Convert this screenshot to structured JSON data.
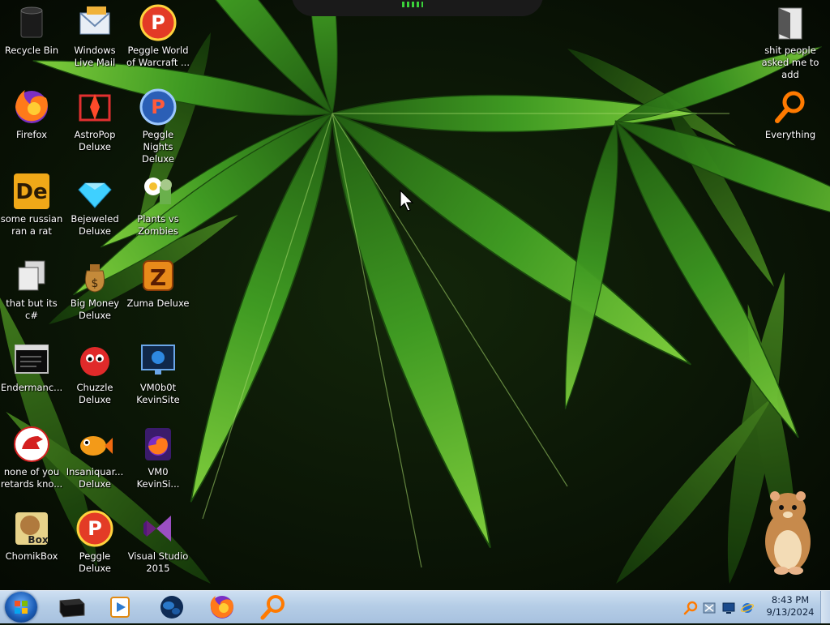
{
  "desktop": {
    "icons": [
      {
        "id": "recycle-bin",
        "label": "Recycle Bin",
        "icon": "recycle-bin-icon"
      },
      {
        "id": "windows-live-mail",
        "label": "Windows Live Mail",
        "icon": "mail-icon"
      },
      {
        "id": "peggle-world",
        "label": "Peggle World of Warcraft ...",
        "icon": "peggle-icon"
      },
      {
        "id": "firefox",
        "label": "Firefox",
        "icon": "firefox-icon"
      },
      {
        "id": "astropop",
        "label": "AstroPop Deluxe",
        "icon": "astropop-icon"
      },
      {
        "id": "peggle-nights",
        "label": "Peggle Nights Deluxe",
        "icon": "peggle-nights-icon"
      },
      {
        "id": "de-rat",
        "label": "some russian ran a rat",
        "icon": "de-icon"
      },
      {
        "id": "bejeweled",
        "label": "Bejeweled Deluxe",
        "icon": "diamond-icon"
      },
      {
        "id": "pvz",
        "label": "Plants vs Zombies",
        "icon": "flower-icon"
      },
      {
        "id": "c-sharp",
        "label": "that but its c#",
        "icon": "copy-icon"
      },
      {
        "id": "big-money",
        "label": "Big Money Deluxe",
        "icon": "money-bag-icon"
      },
      {
        "id": "zuma",
        "label": "Zuma Deluxe",
        "icon": "zuma-icon"
      },
      {
        "id": "endermanc",
        "label": "Endermanc...",
        "icon": "console-icon"
      },
      {
        "id": "chuzzle",
        "label": "Chuzzle Deluxe",
        "icon": "chuzzle-icon"
      },
      {
        "id": "vm0b0t",
        "label": "VM0b0t KevinSite",
        "icon": "vm-icon"
      },
      {
        "id": "retards",
        "label": "none of you retards kno...",
        "icon": "dino-icon"
      },
      {
        "id": "insaniquarium",
        "label": "Insaniquar... Deluxe",
        "icon": "fish-icon"
      },
      {
        "id": "vm0-kevin",
        "label": "VM0 KevinSi...",
        "icon": "firefox-purple-icon"
      },
      {
        "id": "chomikbox",
        "label": "ChomikBox",
        "icon": "hamster-box-icon"
      },
      {
        "id": "peggle-deluxe",
        "label": "Peggle Deluxe",
        "icon": "peggle-icon"
      },
      {
        "id": "visual-studio",
        "label": "Visual Studio 2015",
        "icon": "visual-studio-icon"
      },
      {
        "id": "shit-people",
        "label": "shit people asked me to add",
        "icon": "folder-icon"
      },
      {
        "id": "everything",
        "label": "Everything",
        "icon": "search-icon"
      }
    ],
    "wallpaper": "cannabis-leaf-wallpaper",
    "mascot": "hamster-mascot"
  },
  "taskbar": {
    "start": "windows-orb-icon",
    "pinned": [
      {
        "id": "explorer-dark",
        "icon": "black-box-icon"
      },
      {
        "id": "media-player",
        "icon": "media-player-icon"
      },
      {
        "id": "globe",
        "icon": "globe-icon"
      },
      {
        "id": "firefox",
        "icon": "firefox-icon"
      },
      {
        "id": "everything",
        "icon": "search-icon"
      }
    ],
    "tray": {
      "icons": [
        "search-tray-icon",
        "network-tray-icon",
        "monitor-tray-icon",
        "ie-tray-icon"
      ],
      "time": "8:43 PM",
      "date": "9/13/2024"
    }
  },
  "colors": {
    "taskbar": "#b5cde6",
    "leaf": "#3f9a22",
    "background": "#0a1406"
  }
}
